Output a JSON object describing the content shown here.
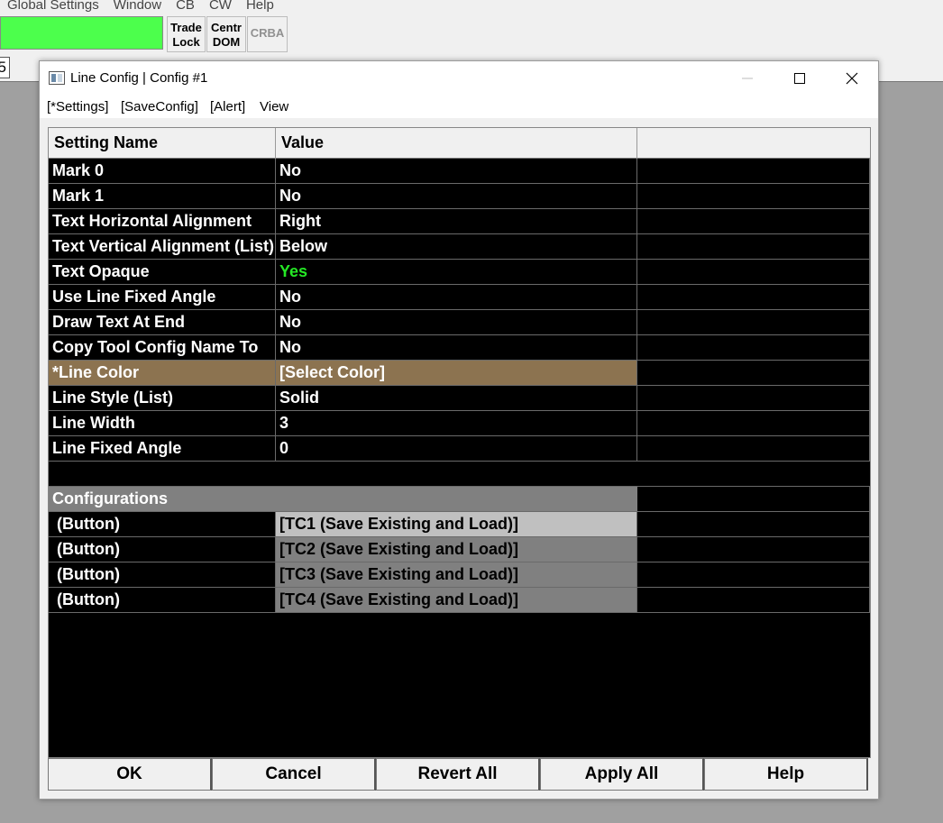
{
  "app": {
    "menu": [
      "Global Settings",
      "Window",
      "CB",
      "CW",
      "Help"
    ],
    "toolbar": {
      "trade_lock": [
        "Trade",
        "Lock"
      ],
      "centr_dom": [
        "Centr",
        "DOM"
      ],
      "crba": "CRBA"
    },
    "number_box": "5"
  },
  "dialog": {
    "title": "Line Config | Config #1",
    "menu": [
      "[*Settings]",
      "[SaveConfig]",
      "[Alert]",
      "View"
    ],
    "grid": {
      "headers": [
        "Setting Name",
        "Value",
        ""
      ],
      "rows": [
        {
          "name": "Mark 0",
          "value": "No"
        },
        {
          "name": "Mark 1",
          "value": "No"
        },
        {
          "name": "Text Horizontal Alignment",
          "value": "Right"
        },
        {
          "name": "Text Vertical Alignment (List)",
          "value": "Below"
        },
        {
          "name": "Text Opaque",
          "value": "Yes"
        },
        {
          "name": "Use Line Fixed Angle",
          "value": "No"
        },
        {
          "name": "Draw Text At End",
          "value": "No"
        },
        {
          "name": "Copy Tool Config Name To",
          "value": "No"
        },
        {
          "name": "*Line Color",
          "value": "[Select Color]"
        },
        {
          "name": "Line Style (List)",
          "value": "Solid"
        },
        {
          "name": "Line Width",
          "value": "3"
        },
        {
          "name": "Line Fixed Angle",
          "value": "0"
        }
      ],
      "section_title": "Configurations",
      "button_rows": [
        {
          "name": "(Button)",
          "value": "[TC1 (Save Existing and Load)]"
        },
        {
          "name": "(Button)",
          "value": "[TC2 (Save Existing and Load)]"
        },
        {
          "name": "(Button)",
          "value": "[TC3 (Save Existing and Load)]"
        },
        {
          "name": "(Button)",
          "value": "[TC4 (Save Existing and Load)]"
        }
      ]
    },
    "buttons": {
      "ok": "OK",
      "cancel": "Cancel",
      "revert_all": "Revert All",
      "apply_all": "Apply All",
      "help": "Help"
    }
  },
  "colors": {
    "green_bar": "#4cff4c",
    "highlight_row": "#8c7350",
    "yes_green": "#25e825",
    "grid_bg": "#000000"
  }
}
